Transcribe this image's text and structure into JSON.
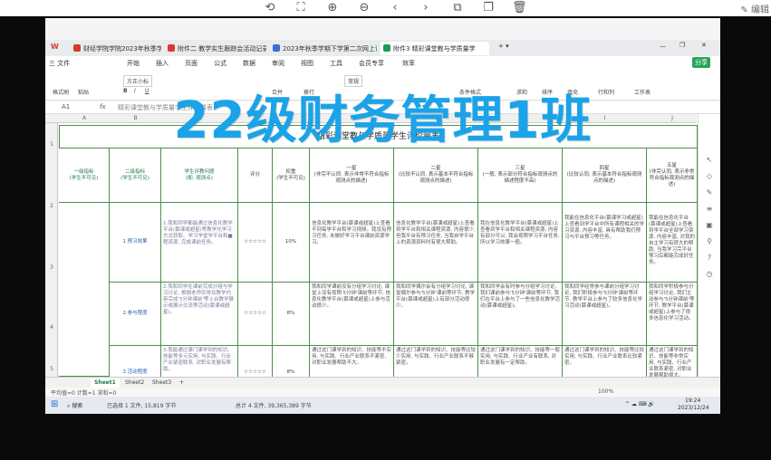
{
  "viewer_toolbar": {
    "icons": [
      "rotate-icon",
      "fullscreen-icon",
      "zoom-in-icon",
      "zoom-out-icon",
      "prev-icon",
      "next-icon",
      "crop-icon",
      "copy-icon",
      "delete-icon"
    ],
    "edit_label": "编辑"
  },
  "tabs": [
    {
      "label": "财经学院学院2023年秋季学期第18年",
      "color": "#d63a2a"
    },
    {
      "label": "附件二 教学实生跟踪会活动记录表",
      "color": "#d63a2a"
    },
    {
      "label": "2023年秋季学期下学第二次网上评教工",
      "color": "#3a6fd6"
    },
    {
      "label": "附件3 精彩课堂教与学质量学",
      "color": "#1e9a5a"
    }
  ],
  "menubar": {
    "items": [
      "三 文件",
      "开始",
      "插入",
      "页面",
      "公式",
      "数据",
      "审阅",
      "视图",
      "工具",
      "会员专享",
      "效率"
    ],
    "share": "分享"
  },
  "toolbar": {
    "items": [
      "格式刷",
      "粘贴",
      "方正小标",
      "B",
      "I",
      "U",
      "合并",
      "换行",
      "常规",
      "条件格式",
      "求和",
      "排序",
      "填充",
      "行和列",
      "工作表"
    ]
  },
  "formula_bar": {
    "cell_ref": "A1",
    "fx": "fx",
    "content": "精彩课堂教与学质量学生评价量表"
  },
  "columns": [
    "A",
    "B",
    "C",
    "D",
    "E",
    "F",
    "G",
    "H",
    "I",
    "J"
  ],
  "rows": [
    "1",
    "2",
    "3",
    "4",
    "5"
  ],
  "sheet": {
    "title": "精彩课堂教与学质量学生评价量表",
    "headers": [
      "一级指标\n(学生不可见)",
      "二级指标\n(学生不可见)",
      "学生评教问题\n(即, 观测点)",
      "评分",
      "权重\n(学生不可见)",
      "一星\n(非完不认同, 表示非常不符合指标观测点的描述)",
      "二星\n(比较不认同, 表示基本不符合指标观测点的描述)",
      "三星\n(一般, 表示部分符合指标观测点的描述程度不高)",
      "四星\n(比较认同, 表示基本符合指标观测点的描述)",
      "五星\n(非完认同, 表示非常符合指标观测点的描述)"
    ],
    "rows": [
      {
        "sub_indicator": "1.预习效果",
        "question": "1.我和同学都能通过信息化教学平台(慕课或超星)等教学化学习方式获取、学习学堂学平台和■程资源, 完成课前任务。",
        "score": "☆☆☆☆☆",
        "weight": "10%",
        "stars": [
          "信息化教学平台(慕课或超星)上查看不到每学平台和学习视频。我没有预习任务, 未做好学习平台课前资源学习。",
          "信息化教学平台(慕课或超星)上查看到学平台和相关课程资源, 内容很少, 但我平台有预习任务, 当我自学平台上的资源资料时有很大帮助。",
          "我在信息化教学平台(慕课或超星)上查看到学平台和相关课程资源, 内容有部分可以, 我会按照学习平台任务, 所以学习效果一般。",
          "我能在信息化平台(慕课学习或超星)上查看到学平台中所有课程相关的学习资源, 内容丰富, 具有帮助我们预习与平台预习等任务。",
          "我能在信息化平台(慕课或超星)上查看到学平台全部学习资源, 内容丰富, 对我的自主学习有很大的帮助, 当我学习完平台预习后都能完成好任务。"
        ]
      },
      {
        "sub_indicator": "2.参与程度",
        "question": "2.我和同学在课前完成分组与学习讨论, 根据老师安排及教学内容完成'5分钟课前'等上台教学展示或展示交流等活动(慕课或超星)。",
        "score": "☆☆☆☆☆",
        "weight": "8%",
        "stars": [
          "我和同学课前没有分组学习讨论, 课堂上没有按照'5分钟'课前等环节, 信息化教学平台(慕课或超星)上参与活动很少。",
          "我和同学偶尔会有分组学习讨论, 课堂偶尔参与'5分钟'课前等环节, 教学平台(慕课或超星)上有部分活动很少。",
          "我和同学会有时参与分组学习讨论, 我们课前参与'5分钟'课前等环节, 我们在平台上参与了一些信息化教学活动(慕课或超星)。",
          "我和同学经常参与课前分组学习讨论, 我们积极参与'5分钟'课前等环节, 教学平台上参与了较多信息化学习活动(慕课或超星)。",
          "我和同学积极参与分组学习讨论, 我们主动参与'5分钟课前'等环节, 教学平台(慕课或超星)上参与了很多信息化学习活动。"
        ]
      },
      {
        "sub_indicator": "3.活动程度",
        "question": "3.我能通过课门课学到的知识、技能等多元实用, 与实践、行业产业紧密联系, 对职业发展有帮助。",
        "score": "☆☆☆☆☆",
        "weight": "8%",
        "stars": [
          "通过这门课学到的知识、技能等不实用, 与实践、行业产业联系不紧密, 对职业发展帮助不大。",
          "通过这门课学到的知识、技能等比较少实用, 与实践、行业产业联系不够紧密。",
          "通过这门课学到的知识、技能等一般实用, 与实践、行业产业有联系, 对职业发展有一定帮助。",
          "通过这门课学到的知识、技能等比较实用, 与实践、行业产业联系比较紧密。",
          "通过这门课学到的知识、技能等非常实用, 与实践、行业产业联系紧密, 对职业发展帮助很大。"
        ]
      }
    ]
  },
  "sheet_tabs": [
    "Sheet1",
    "Sheet2",
    "Sheet3",
    "+"
  ],
  "statusbar": {
    "left": "平均值=0  计数=1  求和=0",
    "zoom": "100%"
  },
  "taskbar": {
    "search": "搜索",
    "status_text": "已选择 1 文件, 15,819 字节",
    "status_text2": "总计 4 文件, 39,365,389 字节",
    "time": "19:24",
    "date": "2023/12/24"
  },
  "overlay_title": "22级财务管理1班",
  "colors": {
    "accent_green": "#1e7a4a",
    "overlay_blue": "#1aa3e8",
    "grid_green": "#4e8f4a"
  }
}
